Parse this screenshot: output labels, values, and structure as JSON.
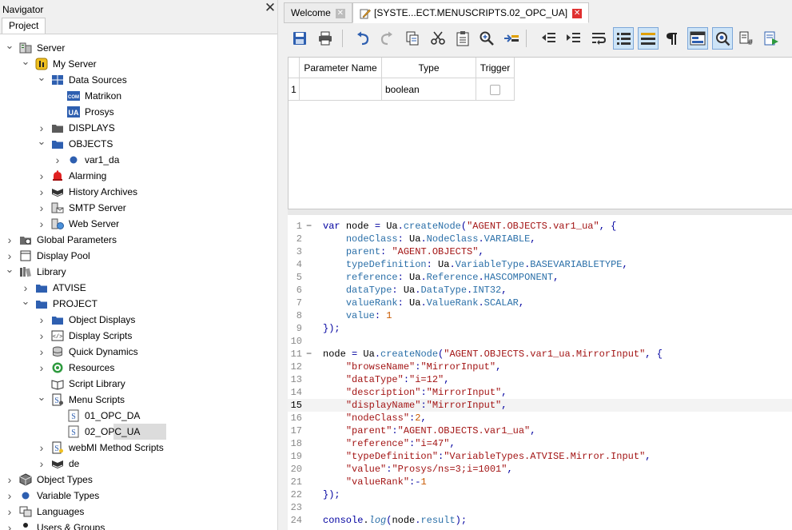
{
  "navigator": {
    "title": "Navigator",
    "close_glyph": "✕",
    "tab": "Project",
    "tree": [
      {
        "label": "Server",
        "icon": "server-icon",
        "expanded": true
      },
      {
        "label": "My Server",
        "icon": "my-server-icon",
        "expanded": true
      },
      {
        "label": "Data Sources",
        "icon": "data-sources-icon",
        "expanded": true
      },
      {
        "label": "Matrikon",
        "icon": "com-badge-icon",
        "badge": "COM"
      },
      {
        "label": "Prosys",
        "icon": "ua-badge-icon",
        "badge": "UA"
      },
      {
        "label": "DISPLAYS",
        "icon": "folder-icon",
        "expanded": false
      },
      {
        "label": "OBJECTS",
        "icon": "folder-blue-icon",
        "expanded": true
      },
      {
        "label": "var1_da",
        "icon": "variable-dot-icon",
        "expanded": false
      },
      {
        "label": "Alarming",
        "icon": "alarm-bell-icon",
        "expanded": false
      },
      {
        "label": "History Archives",
        "icon": "book-icon",
        "expanded": false
      },
      {
        "label": "SMTP Server",
        "icon": "smtp-server-icon",
        "expanded": false
      },
      {
        "label": "Web Server",
        "icon": "web-server-icon",
        "expanded": false
      },
      {
        "label": "Global Parameters",
        "icon": "global-parameters-icon",
        "expanded": false
      },
      {
        "label": "Display Pool",
        "icon": "display-pool-icon",
        "expanded": false
      },
      {
        "label": "Library",
        "icon": "library-icon",
        "expanded": true
      },
      {
        "label": "ATVISE",
        "icon": "folder-blue-icon",
        "expanded": false
      },
      {
        "label": "PROJECT",
        "icon": "folder-blue-icon",
        "expanded": true
      },
      {
        "label": "Object Displays",
        "icon": "folder-blue-icon",
        "expanded": false
      },
      {
        "label": "Display Scripts",
        "icon": "display-scripts-icon",
        "expanded": false
      },
      {
        "label": "Quick Dynamics",
        "icon": "database-icon",
        "expanded": false
      },
      {
        "label": "Resources",
        "icon": "resources-icon",
        "expanded": false
      },
      {
        "label": "Script Library",
        "icon": "script-library-icon"
      },
      {
        "label": "Menu Scripts",
        "icon": "menu-scripts-icon",
        "expanded": true
      },
      {
        "label": "01_OPC_DA",
        "icon": "script-file-icon"
      },
      {
        "label": "02_OPC_UA",
        "icon": "script-file-icon",
        "selected": true
      },
      {
        "label": "webMI Method Scripts",
        "icon": "webmi-scripts-icon",
        "expanded": false
      },
      {
        "label": "de",
        "icon": "book-icon",
        "expanded": false
      },
      {
        "label": "Object Types",
        "icon": "cube-icon",
        "expanded": false
      },
      {
        "label": "Variable Types",
        "icon": "variable-dot-icon",
        "expanded": false
      },
      {
        "label": "Languages",
        "icon": "languages-icon",
        "expanded": false
      },
      {
        "label": "Users & Groups",
        "icon": "users-icon",
        "expanded": false
      }
    ]
  },
  "tabs": [
    {
      "label": "Welcome",
      "close_glyph": "✕",
      "active": false
    },
    {
      "label": "[SYSTE...ECT.MENUSCRIPTS.02_OPC_UA]",
      "close_glyph": "✕",
      "active": true
    }
  ],
  "toolbar": [
    "save-icon",
    "print-icon",
    "undo-icon",
    "redo-icon",
    "copy-icon",
    "cut-icon",
    "paste-icon",
    "find-icon",
    "goto-line-icon",
    "indent-left-icon",
    "indent-right-icon",
    "wrap-icon",
    "list-icon",
    "list-highlight-icon",
    "pilcrow-icon",
    "layout-icon",
    "zoom-icon",
    "script-hash-icon",
    "run-script-icon"
  ],
  "param_table": {
    "headers": [
      "Parameter Name",
      "Type",
      "Trigger"
    ],
    "rows": [
      {
        "num": "1",
        "name": "",
        "type": "boolean",
        "trigger": false
      }
    ]
  },
  "code": {
    "current_line": 15,
    "lines": [
      "var node = Ua.createNode(\"AGENT.OBJECTS.var1_ua\", {",
      "    nodeClass: Ua.NodeClass.VARIABLE,",
      "    parent: \"AGENT.OBJECTS\",",
      "    typeDefinition: Ua.VariableType.BASEVARIABLETYPE,",
      "    reference: Ua.Reference.HASCOMPONENT,",
      "    dataType: Ua.DataType.INT32,",
      "    valueRank: Ua.ValueRank.SCALAR,",
      "    value: 1",
      "});",
      "",
      "node = Ua.createNode(\"AGENT.OBJECTS.var1_ua.MirrorInput\", {",
      "    \"browseName\":\"MirrorInput\",",
      "    \"dataType\":\"i=12\",",
      "    \"description\":\"MirrorInput\",",
      "    \"displayName\":\"MirrorInput\",",
      "    \"nodeClass\":2,",
      "    \"parent\":\"AGENT.OBJECTS.var1_ua\",",
      "    \"reference\":\"i=47\",",
      "    \"typeDefinition\":\"VariableTypes.ATVISE.Mirror.Input\",",
      "    \"value\":\"Prosys/ns=3;i=1001\",",
      "    \"valueRank\":-1",
      "});",
      "",
      "console.log(node.result);"
    ]
  }
}
